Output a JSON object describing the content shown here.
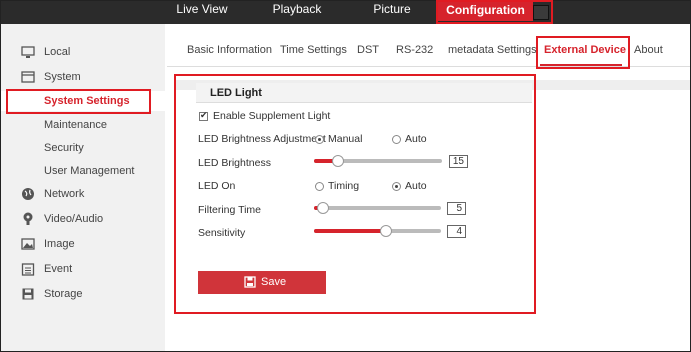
{
  "topnav": {
    "items": [
      {
        "label": "Live View"
      },
      {
        "label": "Playback"
      },
      {
        "label": "Picture"
      },
      {
        "label": "Configuration"
      }
    ]
  },
  "sidebar": {
    "items": [
      {
        "label": "Local",
        "icon": "monitor-icon"
      },
      {
        "label": "System",
        "icon": "window-icon"
      },
      {
        "label": "System Settings"
      },
      {
        "label": "Maintenance"
      },
      {
        "label": "Security"
      },
      {
        "label": "User Management"
      },
      {
        "label": "Network",
        "icon": "globe-icon"
      },
      {
        "label": "Video/Audio",
        "icon": "mic-icon"
      },
      {
        "label": "Image",
        "icon": "image-icon"
      },
      {
        "label": "Event",
        "icon": "calendar-icon"
      },
      {
        "label": "Storage",
        "icon": "disk-icon"
      }
    ]
  },
  "tabs": [
    {
      "label": "Basic Information"
    },
    {
      "label": "Time Settings"
    },
    {
      "label": "DST"
    },
    {
      "label": "RS-232"
    },
    {
      "label": "metadata Settings"
    },
    {
      "label": "External Device"
    },
    {
      "label": "About"
    }
  ],
  "panel": {
    "title": "LED Light",
    "enable_label": "Enable Supplement Light",
    "brightness_adj": {
      "label": "LED Brightness Adjustment",
      "opt1": "Manual",
      "opt2": "Auto"
    },
    "brightness": {
      "label": "LED Brightness",
      "value": "15"
    },
    "led_on": {
      "label": "LED On",
      "opt1": "Timing",
      "opt2": "Auto"
    },
    "filtering": {
      "label": "Filtering Time",
      "value": "5"
    },
    "sensitivity": {
      "label": "Sensitivity",
      "value": "4"
    },
    "save_label": "Save"
  },
  "colors": {
    "accent": "#d6232c",
    "topbar": "#2b2b2b",
    "highlight": "#e01b22"
  }
}
